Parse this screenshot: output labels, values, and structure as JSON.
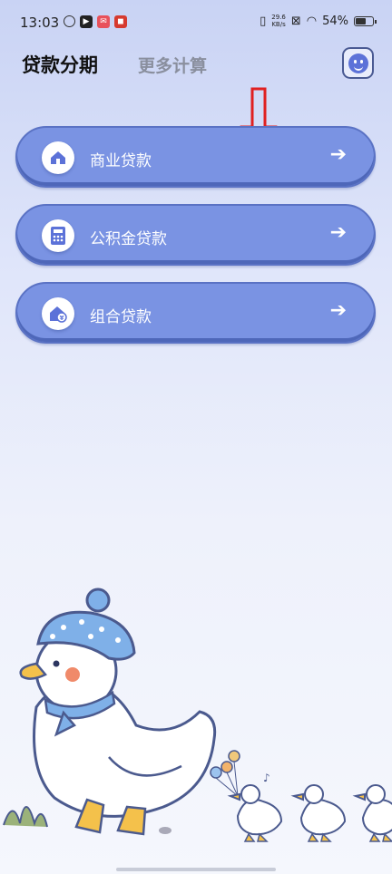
{
  "status_bar": {
    "time": "13:03",
    "net_speed_value": "29.6",
    "net_speed_unit": "KB/s",
    "battery": "54%"
  },
  "header": {
    "tab_active": "贷款分期",
    "tab_inactive": "更多计算"
  },
  "loans": [
    {
      "label": "商业贷款",
      "icon": "house-hand-icon"
    },
    {
      "label": "公积金贷款",
      "icon": "calculator-icon"
    },
    {
      "label": "组合贷款",
      "icon": "house-money-icon"
    }
  ],
  "colors": {
    "card": "#7a93e3",
    "card_border": "#5a72c4",
    "accent": "#5c72d8",
    "annotation": "#e02020"
  }
}
